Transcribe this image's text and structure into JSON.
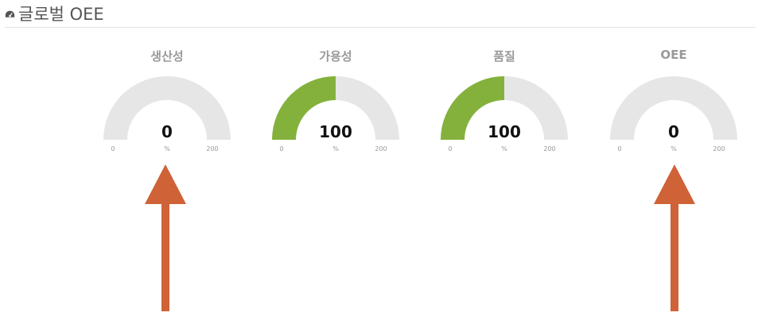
{
  "header": {
    "title": "글로벌 OEE"
  },
  "colors": {
    "gauge_fill": "#84b13b",
    "gauge_track": "#e6e6e6",
    "arrow": "#cf6237"
  },
  "gauges": [
    {
      "label": "생산성",
      "value": "0",
      "min": "0",
      "max": "200",
      "unit": "%",
      "fraction": 0.0
    },
    {
      "label": "가용성",
      "value": "100",
      "min": "0",
      "max": "200",
      "unit": "%",
      "fraction": 0.5
    },
    {
      "label": "품질",
      "value": "100",
      "min": "0",
      "max": "200",
      "unit": "%",
      "fraction": 0.5
    },
    {
      "label": "OEE",
      "value": "0",
      "min": "0",
      "max": "200",
      "unit": "%",
      "fraction": 0.0
    }
  ]
}
